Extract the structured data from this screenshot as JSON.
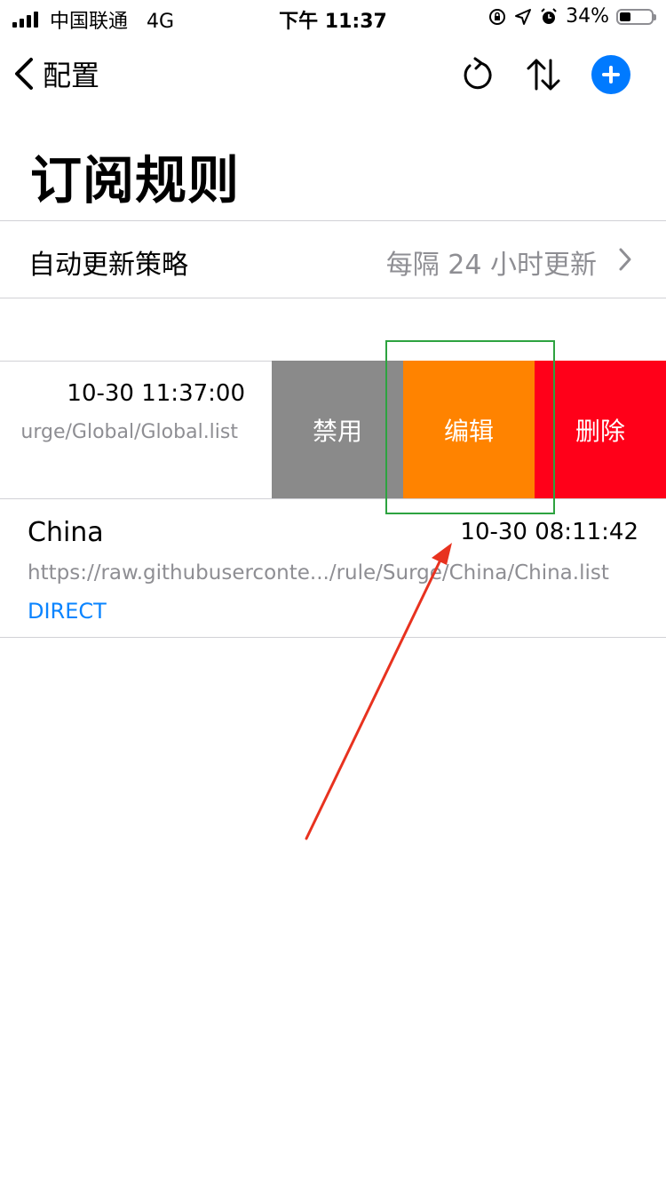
{
  "status_bar": {
    "carrier": "中国联通",
    "network": "4G",
    "time": "下午 11:37",
    "battery_percent": "34%",
    "battery_level": 0.34
  },
  "nav": {
    "back_label": "配置",
    "icons": [
      "back-chevron-icon",
      "refresh-icon",
      "sort-icon",
      "add-icon"
    ]
  },
  "page": {
    "title": "订阅规则"
  },
  "auto_update": {
    "label": "自动更新策略",
    "value": "每隔 24 小时更新"
  },
  "rules": [
    {
      "time": "10-30 11:37:00",
      "url": "urge/Global/Global.list"
    },
    {
      "name": "China",
      "time": "10-30 08:11:42",
      "url": "https://raw.githubuserconte.../rule/Surge/China/China.list",
      "policy": "DIRECT"
    }
  ],
  "swipe_actions": {
    "disable": "禁用",
    "edit": "编辑",
    "delete": "删除"
  },
  "colors": {
    "accent": "#007aff",
    "link": "#0a84ff",
    "disable": "#8a8a8a",
    "edit": "#ff8300",
    "delete": "#ff0019",
    "annotation_box": "#2da340",
    "annotation_arrow": "#e8321f"
  }
}
